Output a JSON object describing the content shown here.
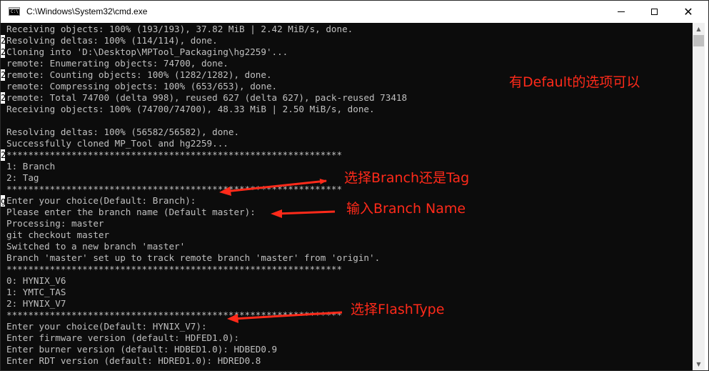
{
  "window": {
    "title": "C:\\Windows\\System32\\cmd.exe",
    "icon": "console-icon",
    "icon_text": "C:\\",
    "controls": {
      "minimize_icon": "minimize-icon",
      "maximize_icon": "maximize-icon",
      "close_icon": "close-icon",
      "close_glyph": "✕"
    }
  },
  "console": {
    "background": "#0c0c0c",
    "text_color": "#c0c0c0",
    "lines": [
      "Receiving objects: 100% (193/193), 37.82 MiB | 2.42 MiB/s, done.",
      "Resolving deltas: 100% (114/114), done.",
      "Cloning into 'D:\\Desktop\\MPTool_Packaging\\hg2259'...",
      "remote: Enumerating objects: 74700, done.",
      "remote: Counting objects: 100% (1282/1282), done.",
      "remote: Compressing objects: 100% (653/653), done.",
      "remote: Total 74700 (delta 998), reused 627 (delta 627), pack-reused 73418",
      "Receiving objects: 100% (74700/74700), 48.33 MiB | 2.50 MiB/s, done.",
      "",
      "Resolving deltas: 100% (56582/56582), done.",
      "Successfully cloned MP_Tool and hg2259...",
      "**************************************************************",
      "1: Branch",
      "2: Tag",
      "**************************************************************",
      "Enter your choice(Default: Branch):",
      "Please enter the branch name (Default master):",
      "Processing: master",
      "git checkout master",
      "Switched to a new branch 'master'",
      "Branch 'master' set up to track remote branch 'master' from 'origin'.",
      "**************************************************************",
      "0: HYNIX_V6",
      "1: YMTC_TAS",
      "2: HYNIX_V7",
      "**************************************************************",
      "Enter your choice(Default: HYNIX_V7):",
      "Enter firmware version (default: HDFED1.0):",
      "Enter burner version (default: HDBED1.0): HDBED0.9",
      "Enter RDT version (default: HDRED1.0): HDRED0.8"
    ],
    "edge_marks": [
      {
        "row": 1,
        "text": "2"
      },
      {
        "row": 2,
        "text": "2"
      },
      {
        "row": 4,
        "text": "2"
      },
      {
        "row": 6,
        "text": "2"
      },
      {
        "row": 11,
        "text": "2"
      },
      {
        "row": 15,
        "text": "g"
      }
    ]
  },
  "annotations": {
    "color": "#ff2a1a",
    "items": [
      {
        "text": "有Default的选项可以",
        "arrow": false
      },
      {
        "text": "选择Branch还是Tag",
        "arrow": true
      },
      {
        "text": "输入Branch Name",
        "arrow": true
      },
      {
        "text": "选择FlashType",
        "arrow": true
      }
    ]
  },
  "scrollbar": {
    "up_icon": "scroll-up-arrow-icon",
    "down_icon": "scroll-down-arrow-icon",
    "up_glyph": "▲",
    "down_glyph": "▼"
  }
}
